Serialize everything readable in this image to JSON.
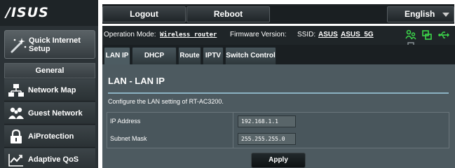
{
  "header": {
    "logo_text": "/ISUS",
    "logout_label": "Logout",
    "reboot_label": "Reboot",
    "language_label": "English"
  },
  "sidebar": {
    "quick_setup_line1": "Quick Internet",
    "quick_setup_line2": "Setup",
    "general_header": "General",
    "items": [
      {
        "label": "Network Map",
        "icon": "network-map-icon"
      },
      {
        "label": "Guest Network",
        "icon": "guest-network-icon"
      },
      {
        "label": "AiProtection",
        "icon": "lock-icon"
      },
      {
        "label": "Adaptive QoS",
        "icon": "qos-chart-icon"
      }
    ]
  },
  "infobar": {
    "operation_mode_label": "Operation Mode:",
    "operation_mode_value": "Wireless router",
    "firmware_label": "Firmware Version:",
    "ssid_label": "SSID:",
    "ssid_1": "ASUS",
    "ssid_2": "ASUS_5G",
    "status_icons": [
      "client-status-icon",
      "network-status-icon",
      "usb-icon",
      "printer-icon"
    ]
  },
  "tabs": [
    {
      "label": "LAN IP",
      "active": true
    },
    {
      "label": "DHCP Server",
      "active": false
    },
    {
      "label": "Route",
      "active": false
    },
    {
      "label": "IPTV",
      "active": false
    },
    {
      "label": "Switch Control",
      "active": false
    }
  ],
  "content": {
    "title": "LAN - LAN IP",
    "description": "Configure the LAN setting of RT-AC3200.",
    "fields": [
      {
        "label": "IP Address",
        "value": "192.168.1.1"
      },
      {
        "label": "Subnet Mask",
        "value": "255.255.255.0"
      }
    ],
    "apply_label": "Apply"
  },
  "colors": {
    "accent_green": "#3cd64a",
    "panel_bg": "#4d5a60",
    "divider": "#8bb2c2"
  }
}
